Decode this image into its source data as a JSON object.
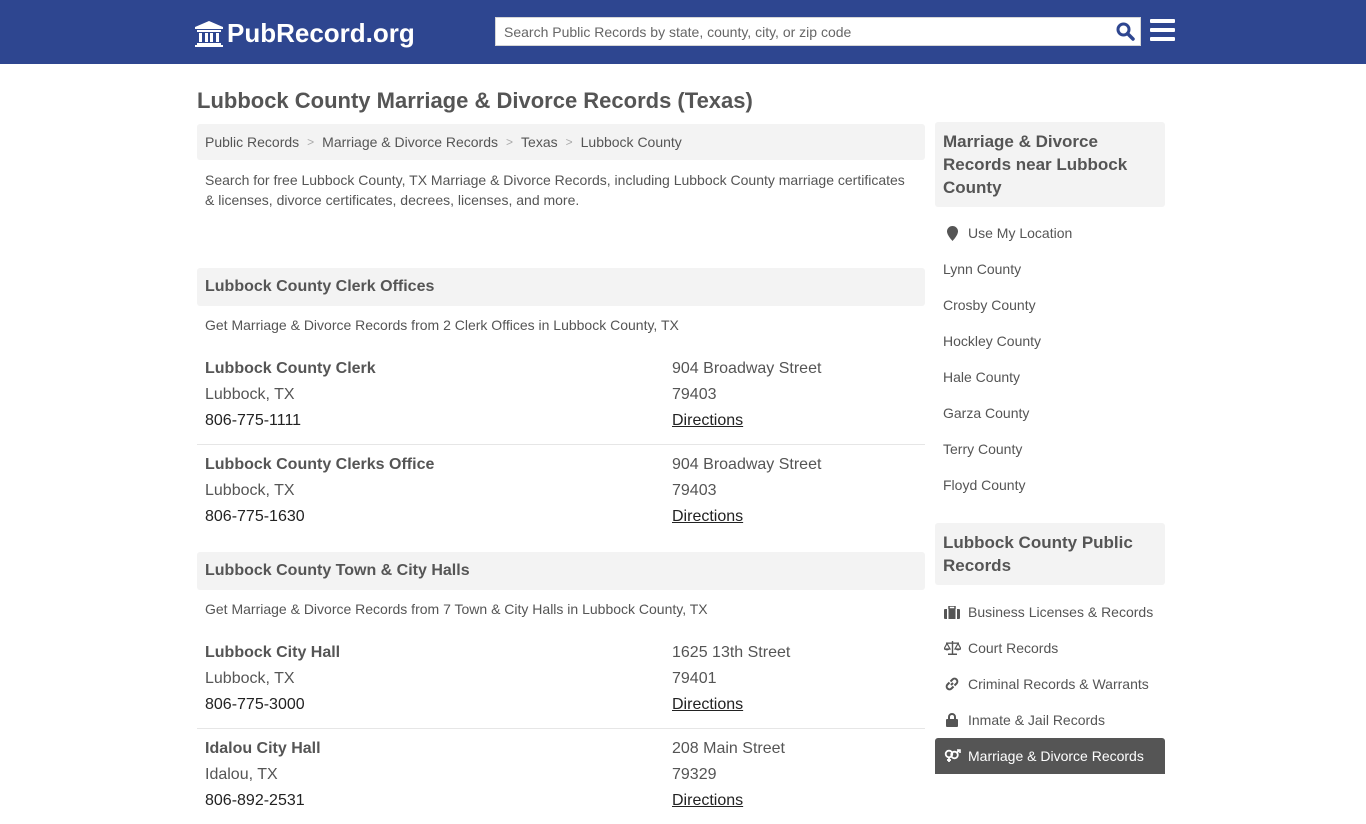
{
  "header": {
    "logo_text": "PubRecord.org",
    "logo_icon": "courthouse-icon",
    "search_placeholder": "Search Public Records by state, county, city, or zip code",
    "search_value": "",
    "search_icon": "search-icon",
    "menu_icon": "hamburger-menu-icon"
  },
  "page": {
    "title": "Lubbock County Marriage & Divorce Records (Texas)",
    "breadcrumb": [
      {
        "label": "Public Records"
      },
      {
        "label": "Marriage & Divorce Records"
      },
      {
        "label": "Texas"
      },
      {
        "label": "Lubbock County"
      }
    ],
    "breadcrumb_separator": ">",
    "intro": "Search for free Lubbock County, TX Marriage & Divorce Records, including Lubbock County marriage certificates & licenses, divorce certificates, decrees, licenses, and more."
  },
  "sections": [
    {
      "title": "Lubbock County Clerk Offices",
      "description": "Get Marriage & Divorce Records from 2 Clerk Offices in Lubbock County, TX",
      "entries": [
        {
          "name": "Lubbock County Clerk",
          "city": "Lubbock, TX",
          "phone": "806-775-1111",
          "street": "904 Broadway Street",
          "zip": "79403",
          "directions": "Directions"
        },
        {
          "name": "Lubbock County Clerks Office",
          "city": "Lubbock, TX",
          "phone": "806-775-1630",
          "street": "904 Broadway Street",
          "zip": "79403",
          "directions": "Directions"
        }
      ]
    },
    {
      "title": "Lubbock County Town & City Halls",
      "description": "Get Marriage & Divorce Records from 7 Town & City Halls in Lubbock County, TX",
      "entries": [
        {
          "name": "Lubbock City Hall",
          "city": "Lubbock, TX",
          "phone": "806-775-3000",
          "street": "1625 13th Street",
          "zip": "79401",
          "directions": "Directions"
        },
        {
          "name": "Idalou City Hall",
          "city": "Idalou, TX",
          "phone": "806-892-2531",
          "street": "208 Main Street",
          "zip": "79329",
          "directions": "Directions"
        }
      ]
    }
  ],
  "sidebar": {
    "nearby": {
      "title": "Marriage & Divorce Records near Lubbock County",
      "use_location": "Use My Location",
      "counties": [
        "Lynn County",
        "Crosby County",
        "Hockley County",
        "Hale County",
        "Garza County",
        "Terry County",
        "Floyd County"
      ]
    },
    "public_records": {
      "title": "Lubbock County Public Records",
      "items": [
        {
          "label": "Business Licenses & Records",
          "icon": "briefcase-icon",
          "active": false
        },
        {
          "label": "Court Records",
          "icon": "scales-icon",
          "active": false
        },
        {
          "label": "Criminal Records & Warrants",
          "icon": "link-icon",
          "active": false
        },
        {
          "label": "Inmate & Jail Records",
          "icon": "lock-icon",
          "active": false
        },
        {
          "label": "Marriage & Divorce Records",
          "icon": "venus-mars-icon",
          "active": true
        }
      ]
    }
  },
  "colors": {
    "header_bg": "#2e4690",
    "search_icon": "#2e4690",
    "panel_bg": "#f3f3f3",
    "active_item_bg": "#555555",
    "text": "#555555"
  }
}
